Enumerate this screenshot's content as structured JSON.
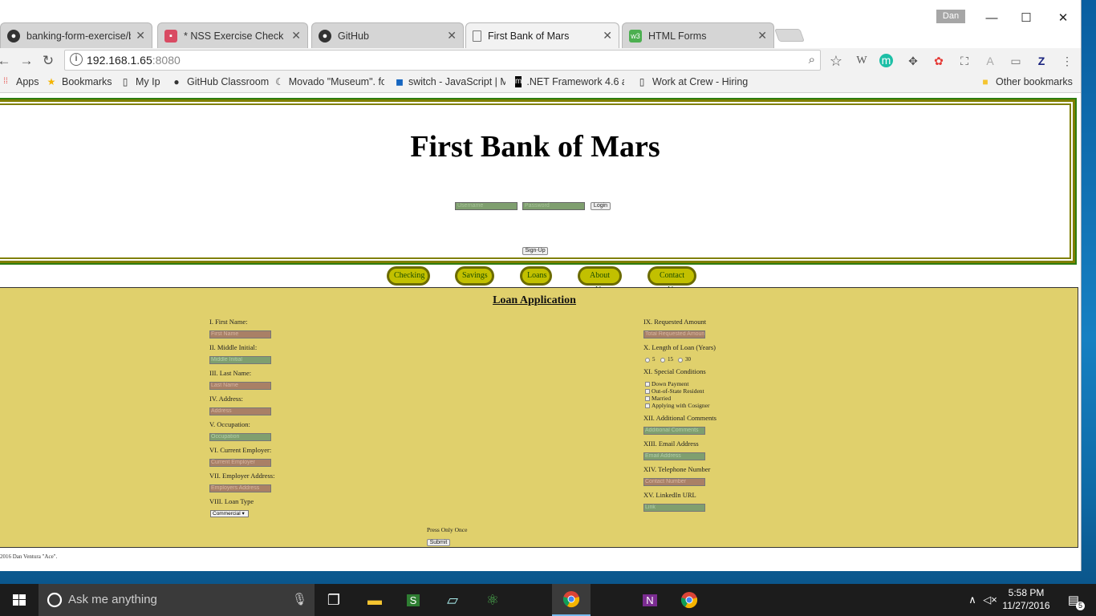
{
  "browser": {
    "user": "Dan",
    "tabs": [
      {
        "label": "banking-form-exercise/b",
        "icon": "github-icon"
      },
      {
        "label": "* NSS Exercise Check She",
        "icon": "sheet-icon"
      },
      {
        "label": "GitHub",
        "icon": "github-icon"
      },
      {
        "label": "First Bank of Mars",
        "icon": "page-icon"
      },
      {
        "label": "HTML Forms",
        "icon": "w3-icon"
      }
    ],
    "url_host": "192.168.1.65",
    "url_port": ":8080",
    "bookmarks": [
      "Apps",
      "Bookmarks",
      "My Ip",
      "GitHub Classroom",
      "Movado \"Museum\". fo",
      "switch - JavaScript | M",
      ".NET Framework 4.6 a",
      "Work at Crew - Hiring"
    ],
    "other_bookmarks": "Other bookmarks"
  },
  "page": {
    "title": "First Bank of Mars",
    "login": {
      "username_placeholder": "Username",
      "password_placeholder": "Password",
      "login_label": "Login",
      "signup_label": "Sign-Up"
    },
    "nav": [
      "Checking",
      "Savings",
      "Loans",
      "About Us",
      "Contact Us"
    ],
    "loan": {
      "heading": "Loan Application",
      "left_fields": [
        {
          "label": "I. First Name:",
          "placeholder": "First Name"
        },
        {
          "label": "II. Middle Initial:",
          "placeholder": "Middle Initial"
        },
        {
          "label": "III. Last Name:",
          "placeholder": "Last Name"
        },
        {
          "label": "IV. Address:",
          "placeholder": "Address"
        },
        {
          "label": "V. Occupation:",
          "placeholder": "Occupation"
        },
        {
          "label": "VI. Current Employer:",
          "placeholder": "Current Employer"
        },
        {
          "label": "VII. Employer Address:",
          "placeholder": "Employers Address"
        }
      ],
      "loan_type_label": "VIII. Loan Type",
      "loan_type_value": "Commercial",
      "requested_label": "IX. Requested Amount",
      "requested_placeholder": "Total Requested Amount",
      "length_label": "X. Length of Loan (Years)",
      "length_options": [
        "5",
        "15",
        "30"
      ],
      "conditions_label": "XI. Special Conditions",
      "conditions": [
        "Down Payment",
        "Out-of-State Resident",
        "Married",
        "Applying with Cosigner"
      ],
      "right_fields": [
        {
          "label": "XII. Additional Comments",
          "placeholder": "Additional Comments"
        },
        {
          "label": "XIII. Email Address",
          "placeholder": "Email Address"
        },
        {
          "label": "XIV. Telephone Number",
          "placeholder": "Contact Number"
        },
        {
          "label": "XV. LinkedIn URL",
          "placeholder": "Link"
        }
      ],
      "press_once": "Press Only Once",
      "submit": "Submit"
    },
    "footer": "2016 Dan Ventura \"Ace\"."
  },
  "taskbar": {
    "search_placeholder": "Ask me anything",
    "time": "5:58 PM",
    "date": "11/27/2016",
    "notifications": "5"
  }
}
